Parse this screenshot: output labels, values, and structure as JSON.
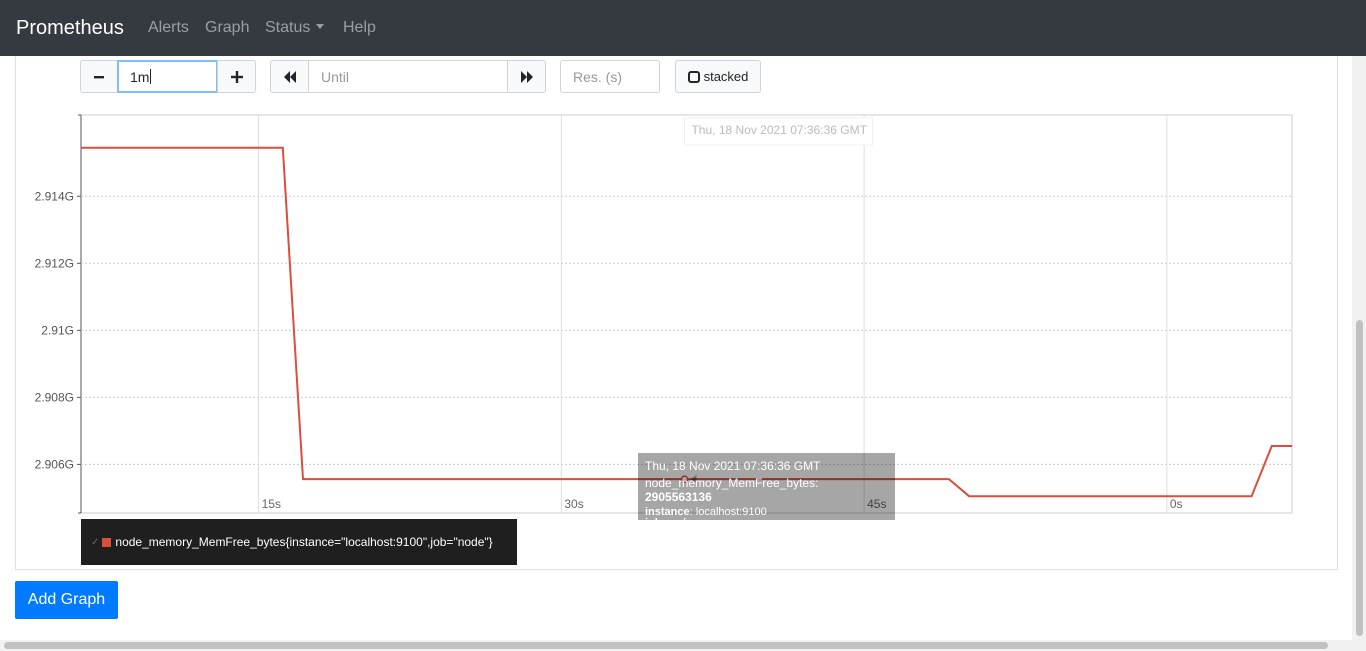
{
  "navbar": {
    "brand": "Prometheus",
    "items": [
      {
        "label": "Alerts"
      },
      {
        "label": "Graph"
      },
      {
        "label": "Status"
      },
      {
        "label": "Help"
      }
    ]
  },
  "controls": {
    "range_minus": "−",
    "range_value": "1m",
    "range_plus": "+",
    "until_placeholder": "Until",
    "res_placeholder": "Res. (s)",
    "stacked_label": "stacked"
  },
  "chart_data": {
    "type": "line",
    "x_ticks": [
      "15s",
      "30s",
      "45s",
      "0s"
    ],
    "y_ticks": [
      "2.914G",
      "2.912G",
      "2.91G",
      "2.908G",
      "2.906G"
    ],
    "x_range_seconds": [
      -53.8,
      6.2
    ],
    "ylim": [
      2904550000,
      2916425000
    ],
    "grid": true,
    "hover_label": "Thu, 18 Nov 2021 07:36:36 GMT",
    "series": [
      {
        "name": "node_memory_MemFree_bytes{instance=\"localhost:9100\",job=\"node\"}",
        "color": "#dc4e3c",
        "x": [
          -53.8,
          -43.8,
          -42.8,
          -20.8,
          -10.8,
          -9.8,
          4.2,
          5.2,
          6.2
        ],
        "y": [
          2915450000,
          2915450000,
          2905560000,
          2905560000,
          2905560000,
          2905050000,
          2905050000,
          2906550000,
          2906550000
        ]
      }
    ]
  },
  "tooltip": {
    "time": "Thu, 18 Nov 2021 07:36:36 GMT",
    "metric": "node_memory_MemFree_bytes",
    "value": "2905563136",
    "instance_label": "instance",
    "instance_value": "localhost:9100",
    "job_label": "job",
    "job_value": "node"
  },
  "legend": {
    "check": "✓",
    "series_label": "node_memory_MemFree_bytes{instance=\"localhost:9100\",job=\"node\"}"
  },
  "add_graph_label": "Add Graph"
}
